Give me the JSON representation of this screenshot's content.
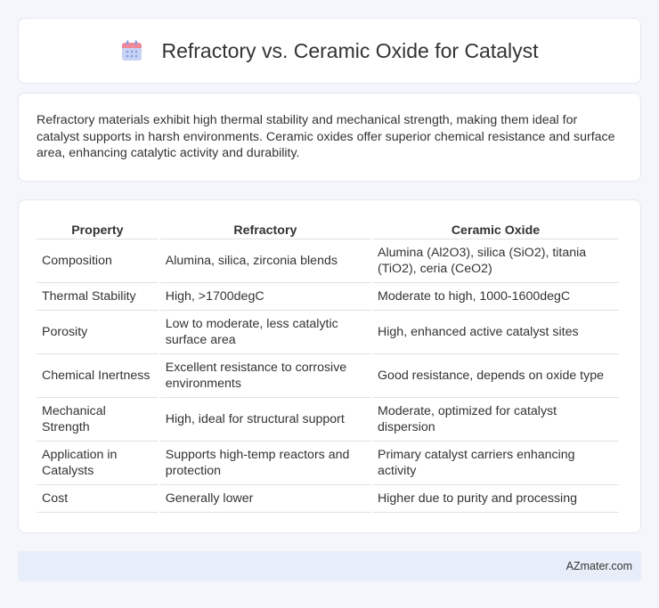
{
  "header": {
    "title": "Refractory vs. Ceramic Oxide for Catalyst",
    "icon": "calendar-icon",
    "icon_colors": {
      "top": "#f07a8a",
      "body": "#b9c8f2",
      "dots": "#8a9be0"
    }
  },
  "intro": {
    "text": "Refractory materials exhibit high thermal stability and mechanical strength, making them ideal for catalyst supports in harsh environments. Ceramic oxides offer superior chemical resistance and surface area, enhancing catalytic activity and durability."
  },
  "table": {
    "headers": [
      "Property",
      "Refractory",
      "Ceramic Oxide"
    ],
    "rows": [
      [
        "Composition",
        "Alumina, silica, zirconia blends",
        "Alumina (Al2O3), silica (SiO2), titania (TiO2), ceria (CeO2)"
      ],
      [
        "Thermal Stability",
        "High, >1700degC",
        "Moderate to high, 1000-1600degC"
      ],
      [
        "Porosity",
        "Low to moderate, less catalytic surface area",
        "High, enhanced active catalyst sites"
      ],
      [
        "Chemical Inertness",
        "Excellent resistance to corrosive environments",
        "Good resistance, depends on oxide type"
      ],
      [
        "Mechanical Strength",
        "High, ideal for structural support",
        "Moderate, optimized for catalyst dispersion"
      ],
      [
        "Application in Catalysts",
        "Supports high-temp reactors and protection",
        "Primary catalyst carriers enhancing activity"
      ],
      [
        "Cost",
        "Generally lower",
        "Higher due to purity and processing"
      ]
    ]
  },
  "footer": {
    "brand": "AZmater.com"
  }
}
